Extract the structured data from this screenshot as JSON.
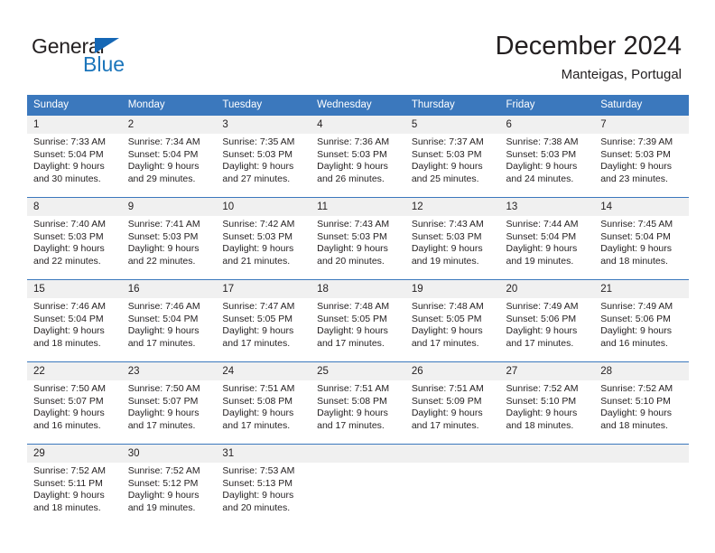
{
  "brand": {
    "name_part1": "General",
    "name_part2": "Blue",
    "colors": {
      "blue": "#1b75bb",
      "dark": "#231f20",
      "header_blue": "#3b78bd",
      "daynum_bg": "#f0f0f0"
    }
  },
  "header": {
    "title": "December 2024",
    "subtitle": "Manteigas, Portugal"
  },
  "calendar": {
    "weekday_headers": [
      "Sunday",
      "Monday",
      "Tuesday",
      "Wednesday",
      "Thursday",
      "Friday",
      "Saturday"
    ],
    "weeks": [
      [
        {
          "day": "1",
          "sunrise": "Sunrise: 7:33 AM",
          "sunset": "Sunset: 5:04 PM",
          "daylight_line1": "Daylight: 9 hours",
          "daylight_line2": "and 30 minutes."
        },
        {
          "day": "2",
          "sunrise": "Sunrise: 7:34 AM",
          "sunset": "Sunset: 5:04 PM",
          "daylight_line1": "Daylight: 9 hours",
          "daylight_line2": "and 29 minutes."
        },
        {
          "day": "3",
          "sunrise": "Sunrise: 7:35 AM",
          "sunset": "Sunset: 5:03 PM",
          "daylight_line1": "Daylight: 9 hours",
          "daylight_line2": "and 27 minutes."
        },
        {
          "day": "4",
          "sunrise": "Sunrise: 7:36 AM",
          "sunset": "Sunset: 5:03 PM",
          "daylight_line1": "Daylight: 9 hours",
          "daylight_line2": "and 26 minutes."
        },
        {
          "day": "5",
          "sunrise": "Sunrise: 7:37 AM",
          "sunset": "Sunset: 5:03 PM",
          "daylight_line1": "Daylight: 9 hours",
          "daylight_line2": "and 25 minutes."
        },
        {
          "day": "6",
          "sunrise": "Sunrise: 7:38 AM",
          "sunset": "Sunset: 5:03 PM",
          "daylight_line1": "Daylight: 9 hours",
          "daylight_line2": "and 24 minutes."
        },
        {
          "day": "7",
          "sunrise": "Sunrise: 7:39 AM",
          "sunset": "Sunset: 5:03 PM",
          "daylight_line1": "Daylight: 9 hours",
          "daylight_line2": "and 23 minutes."
        }
      ],
      [
        {
          "day": "8",
          "sunrise": "Sunrise: 7:40 AM",
          "sunset": "Sunset: 5:03 PM",
          "daylight_line1": "Daylight: 9 hours",
          "daylight_line2": "and 22 minutes."
        },
        {
          "day": "9",
          "sunrise": "Sunrise: 7:41 AM",
          "sunset": "Sunset: 5:03 PM",
          "daylight_line1": "Daylight: 9 hours",
          "daylight_line2": "and 22 minutes."
        },
        {
          "day": "10",
          "sunrise": "Sunrise: 7:42 AM",
          "sunset": "Sunset: 5:03 PM",
          "daylight_line1": "Daylight: 9 hours",
          "daylight_line2": "and 21 minutes."
        },
        {
          "day": "11",
          "sunrise": "Sunrise: 7:43 AM",
          "sunset": "Sunset: 5:03 PM",
          "daylight_line1": "Daylight: 9 hours",
          "daylight_line2": "and 20 minutes."
        },
        {
          "day": "12",
          "sunrise": "Sunrise: 7:43 AM",
          "sunset": "Sunset: 5:03 PM",
          "daylight_line1": "Daylight: 9 hours",
          "daylight_line2": "and 19 minutes."
        },
        {
          "day": "13",
          "sunrise": "Sunrise: 7:44 AM",
          "sunset": "Sunset: 5:04 PM",
          "daylight_line1": "Daylight: 9 hours",
          "daylight_line2": "and 19 minutes."
        },
        {
          "day": "14",
          "sunrise": "Sunrise: 7:45 AM",
          "sunset": "Sunset: 5:04 PM",
          "daylight_line1": "Daylight: 9 hours",
          "daylight_line2": "and 18 minutes."
        }
      ],
      [
        {
          "day": "15",
          "sunrise": "Sunrise: 7:46 AM",
          "sunset": "Sunset: 5:04 PM",
          "daylight_line1": "Daylight: 9 hours",
          "daylight_line2": "and 18 minutes."
        },
        {
          "day": "16",
          "sunrise": "Sunrise: 7:46 AM",
          "sunset": "Sunset: 5:04 PM",
          "daylight_line1": "Daylight: 9 hours",
          "daylight_line2": "and 17 minutes."
        },
        {
          "day": "17",
          "sunrise": "Sunrise: 7:47 AM",
          "sunset": "Sunset: 5:05 PM",
          "daylight_line1": "Daylight: 9 hours",
          "daylight_line2": "and 17 minutes."
        },
        {
          "day": "18",
          "sunrise": "Sunrise: 7:48 AM",
          "sunset": "Sunset: 5:05 PM",
          "daylight_line1": "Daylight: 9 hours",
          "daylight_line2": "and 17 minutes."
        },
        {
          "day": "19",
          "sunrise": "Sunrise: 7:48 AM",
          "sunset": "Sunset: 5:05 PM",
          "daylight_line1": "Daylight: 9 hours",
          "daylight_line2": "and 17 minutes."
        },
        {
          "day": "20",
          "sunrise": "Sunrise: 7:49 AM",
          "sunset": "Sunset: 5:06 PM",
          "daylight_line1": "Daylight: 9 hours",
          "daylight_line2": "and 17 minutes."
        },
        {
          "day": "21",
          "sunrise": "Sunrise: 7:49 AM",
          "sunset": "Sunset: 5:06 PM",
          "daylight_line1": "Daylight: 9 hours",
          "daylight_line2": "and 16 minutes."
        }
      ],
      [
        {
          "day": "22",
          "sunrise": "Sunrise: 7:50 AM",
          "sunset": "Sunset: 5:07 PM",
          "daylight_line1": "Daylight: 9 hours",
          "daylight_line2": "and 16 minutes."
        },
        {
          "day": "23",
          "sunrise": "Sunrise: 7:50 AM",
          "sunset": "Sunset: 5:07 PM",
          "daylight_line1": "Daylight: 9 hours",
          "daylight_line2": "and 17 minutes."
        },
        {
          "day": "24",
          "sunrise": "Sunrise: 7:51 AM",
          "sunset": "Sunset: 5:08 PM",
          "daylight_line1": "Daylight: 9 hours",
          "daylight_line2": "and 17 minutes."
        },
        {
          "day": "25",
          "sunrise": "Sunrise: 7:51 AM",
          "sunset": "Sunset: 5:08 PM",
          "daylight_line1": "Daylight: 9 hours",
          "daylight_line2": "and 17 minutes."
        },
        {
          "day": "26",
          "sunrise": "Sunrise: 7:51 AM",
          "sunset": "Sunset: 5:09 PM",
          "daylight_line1": "Daylight: 9 hours",
          "daylight_line2": "and 17 minutes."
        },
        {
          "day": "27",
          "sunrise": "Sunrise: 7:52 AM",
          "sunset": "Sunset: 5:10 PM",
          "daylight_line1": "Daylight: 9 hours",
          "daylight_line2": "and 18 minutes."
        },
        {
          "day": "28",
          "sunrise": "Sunrise: 7:52 AM",
          "sunset": "Sunset: 5:10 PM",
          "daylight_line1": "Daylight: 9 hours",
          "daylight_line2": "and 18 minutes."
        }
      ],
      [
        {
          "day": "29",
          "sunrise": "Sunrise: 7:52 AM",
          "sunset": "Sunset: 5:11 PM",
          "daylight_line1": "Daylight: 9 hours",
          "daylight_line2": "and 18 minutes."
        },
        {
          "day": "30",
          "sunrise": "Sunrise: 7:52 AM",
          "sunset": "Sunset: 5:12 PM",
          "daylight_line1": "Daylight: 9 hours",
          "daylight_line2": "and 19 minutes."
        },
        {
          "day": "31",
          "sunrise": "Sunrise: 7:53 AM",
          "sunset": "Sunset: 5:13 PM",
          "daylight_line1": "Daylight: 9 hours",
          "daylight_line2": "and 20 minutes."
        },
        {
          "day": "",
          "sunrise": "",
          "sunset": "",
          "daylight_line1": "",
          "daylight_line2": ""
        },
        {
          "day": "",
          "sunrise": "",
          "sunset": "",
          "daylight_line1": "",
          "daylight_line2": ""
        },
        {
          "day": "",
          "sunrise": "",
          "sunset": "",
          "daylight_line1": "",
          "daylight_line2": ""
        },
        {
          "day": "",
          "sunrise": "",
          "sunset": "",
          "daylight_line1": "",
          "daylight_line2": ""
        }
      ]
    ]
  }
}
